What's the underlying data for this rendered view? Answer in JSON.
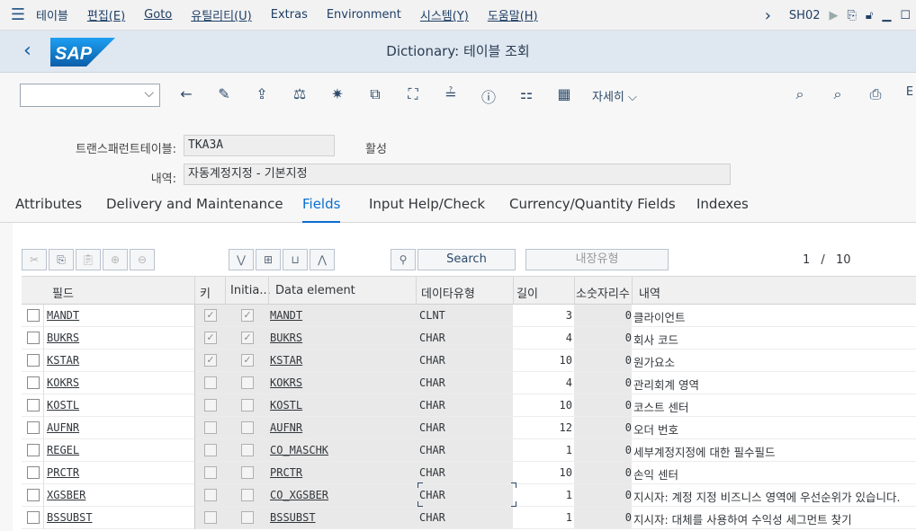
{
  "menubar": {
    "items": [
      "테이블",
      "편집(E)",
      "Goto",
      "유틸리티(U)",
      "Extras",
      "Environment",
      "시스템(Y)",
      "도움말(H)"
    ],
    "right_more": "›",
    "system_id": "SH02"
  },
  "titlebar": {
    "title": "Dictionary: 테이블 조회",
    "logo_text": "SAP",
    "brand_color": "#0a6ed1"
  },
  "toolbar": {
    "command_field_value": "",
    "detail_label": "자세히",
    "icons": [
      "back-arrow",
      "edit-pencil",
      "activate",
      "check-balance",
      "magic-wand",
      "where-used",
      "hierarchy",
      "display-object",
      "info",
      "org-chart",
      "table-grid",
      "search",
      "search-plus",
      "print",
      "exit"
    ]
  },
  "form": {
    "transparent_table_label": "트랜스패런트테이블:",
    "table_name": "TKA3A",
    "status": "활성",
    "description_label": "내역:",
    "description": "자동계정지정 - 기본지정"
  },
  "tabs": [
    {
      "label": "Attributes",
      "active": false
    },
    {
      "label": "Delivery and Maintenance",
      "active": false
    },
    {
      "label": "Fields",
      "active": true
    },
    {
      "label": "Input Help/Check",
      "active": false
    },
    {
      "label": "Currency/Quantity Fields",
      "active": false
    },
    {
      "label": "Indexes",
      "active": false
    }
  ],
  "grid_toolbar": {
    "search_label": "Search",
    "builtin_type_label": "내장유형",
    "pager_current": "1",
    "pager_sep": "/",
    "pager_total": "10"
  },
  "grid": {
    "headers": [
      "필드",
      "키",
      "Initia...",
      "Data element",
      "데이타유형",
      "길이",
      "소숫자리수",
      "내역"
    ],
    "rows": [
      {
        "field": "MANDT",
        "key": true,
        "initial": true,
        "data_element": "MANDT",
        "type": "CLNT",
        "length": "3",
        "decimals": "0",
        "description": "클라이언트"
      },
      {
        "field": "BUKRS",
        "key": true,
        "initial": true,
        "data_element": "BUKRS",
        "type": "CHAR",
        "length": "4",
        "decimals": "0",
        "description": "회사 코드"
      },
      {
        "field": "KSTAR",
        "key": true,
        "initial": true,
        "data_element": "KSTAR",
        "type": "CHAR",
        "length": "10",
        "decimals": "0",
        "description": "원가요소"
      },
      {
        "field": "KOKRS",
        "key": false,
        "initial": false,
        "data_element": "KOKRS",
        "type": "CHAR",
        "length": "4",
        "decimals": "0",
        "description": "관리회계 영역"
      },
      {
        "field": "KOSTL",
        "key": false,
        "initial": false,
        "data_element": "KOSTL",
        "type": "CHAR",
        "length": "10",
        "decimals": "0",
        "description": "코스트 센터"
      },
      {
        "field": "AUFNR",
        "key": false,
        "initial": false,
        "data_element": "AUFNR",
        "type": "CHAR",
        "length": "12",
        "decimals": "0",
        "description": "오더 번호"
      },
      {
        "field": "REGEL",
        "key": false,
        "initial": false,
        "data_element": "CO_MASCHK",
        "type": "CHAR",
        "length": "1",
        "decimals": "0",
        "description": "세부계정지정에 대한 필수필드"
      },
      {
        "field": "PRCTR",
        "key": false,
        "initial": false,
        "data_element": "PRCTR",
        "type": "CHAR",
        "length": "10",
        "decimals": "0",
        "description": "손익 센터"
      },
      {
        "field": "XGSBER",
        "key": false,
        "initial": false,
        "data_element": "CO_XGSBER",
        "type": "CHAR",
        "length": "1",
        "decimals": "0",
        "description": "지시자: 계정 지정 비즈니스 영역에 우선순위가 있습니다."
      },
      {
        "field": "BSSUBST",
        "key": false,
        "initial": false,
        "data_element": "BSSUBST",
        "type": "CHAR",
        "length": "1",
        "decimals": "0",
        "description": "지시자: 대체를 사용하여 수익성 세그먼트 찾기"
      }
    ]
  }
}
